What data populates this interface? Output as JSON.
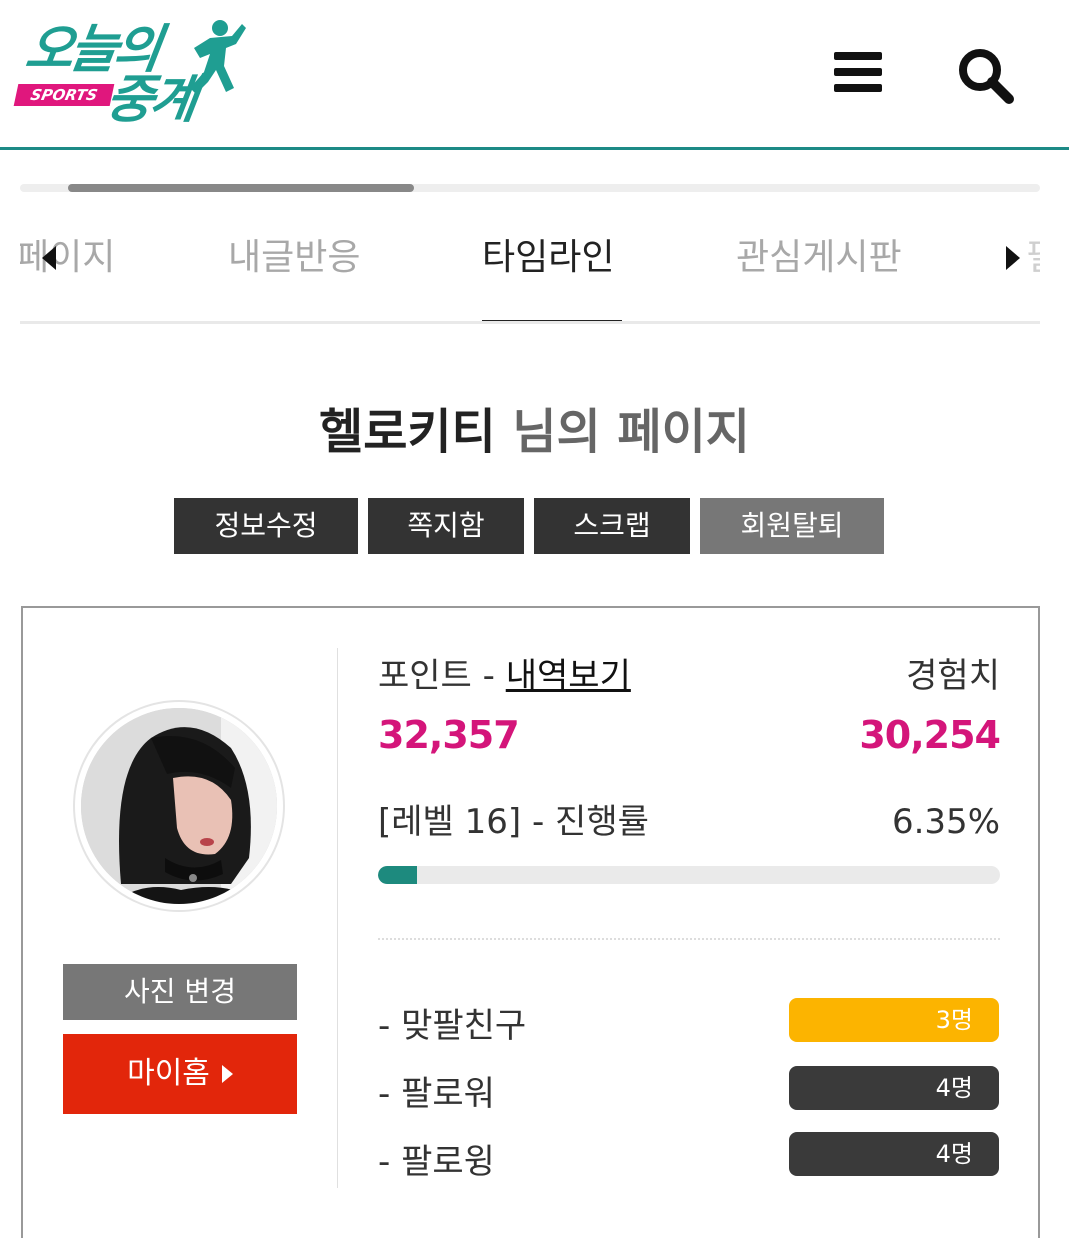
{
  "header": {
    "logo_main": "오늘의",
    "logo_sub": "중계",
    "logo_badge": "SPORTS"
  },
  "tabs": {
    "prev_partial": "페이지",
    "items": [
      {
        "label": "내글반응",
        "active": false
      },
      {
        "label": "타임라인",
        "active": true
      },
      {
        "label": "관심게시판",
        "active": false
      }
    ],
    "next_partial": "필"
  },
  "profile_header": {
    "nickname": "헬로키티",
    "suffix": " 님의 페이지"
  },
  "actions": {
    "edit_info": "정보수정",
    "messages": "쪽지함",
    "scrap": "스크랩",
    "withdraw": "회원탈퇴"
  },
  "profile": {
    "change_photo": "사진 변경",
    "my_home": "마이홈",
    "points_label": "포인트 - ",
    "points_history_link": "내역보기",
    "points_value": "32,357",
    "exp_label": "경험치",
    "exp_value": "30,254",
    "level_label": "[레벨 16] - 진행률",
    "progress_text": "6.35%",
    "progress_fraction": 0.0635
  },
  "social": [
    {
      "label": "- 맞팔친구",
      "count": "3명",
      "color": "#fcb400"
    },
    {
      "label": "- 팔로워",
      "count": "4명",
      "color": "#3a3a3a"
    },
    {
      "label": "- 팔로윙",
      "count": "4명",
      "color": "#3a3a3a"
    }
  ],
  "colors": {
    "brand_teal": "#1d8a86",
    "accent_pink": "#d4157a",
    "home_red": "#e2260b",
    "badge_yellow": "#fcb400"
  }
}
